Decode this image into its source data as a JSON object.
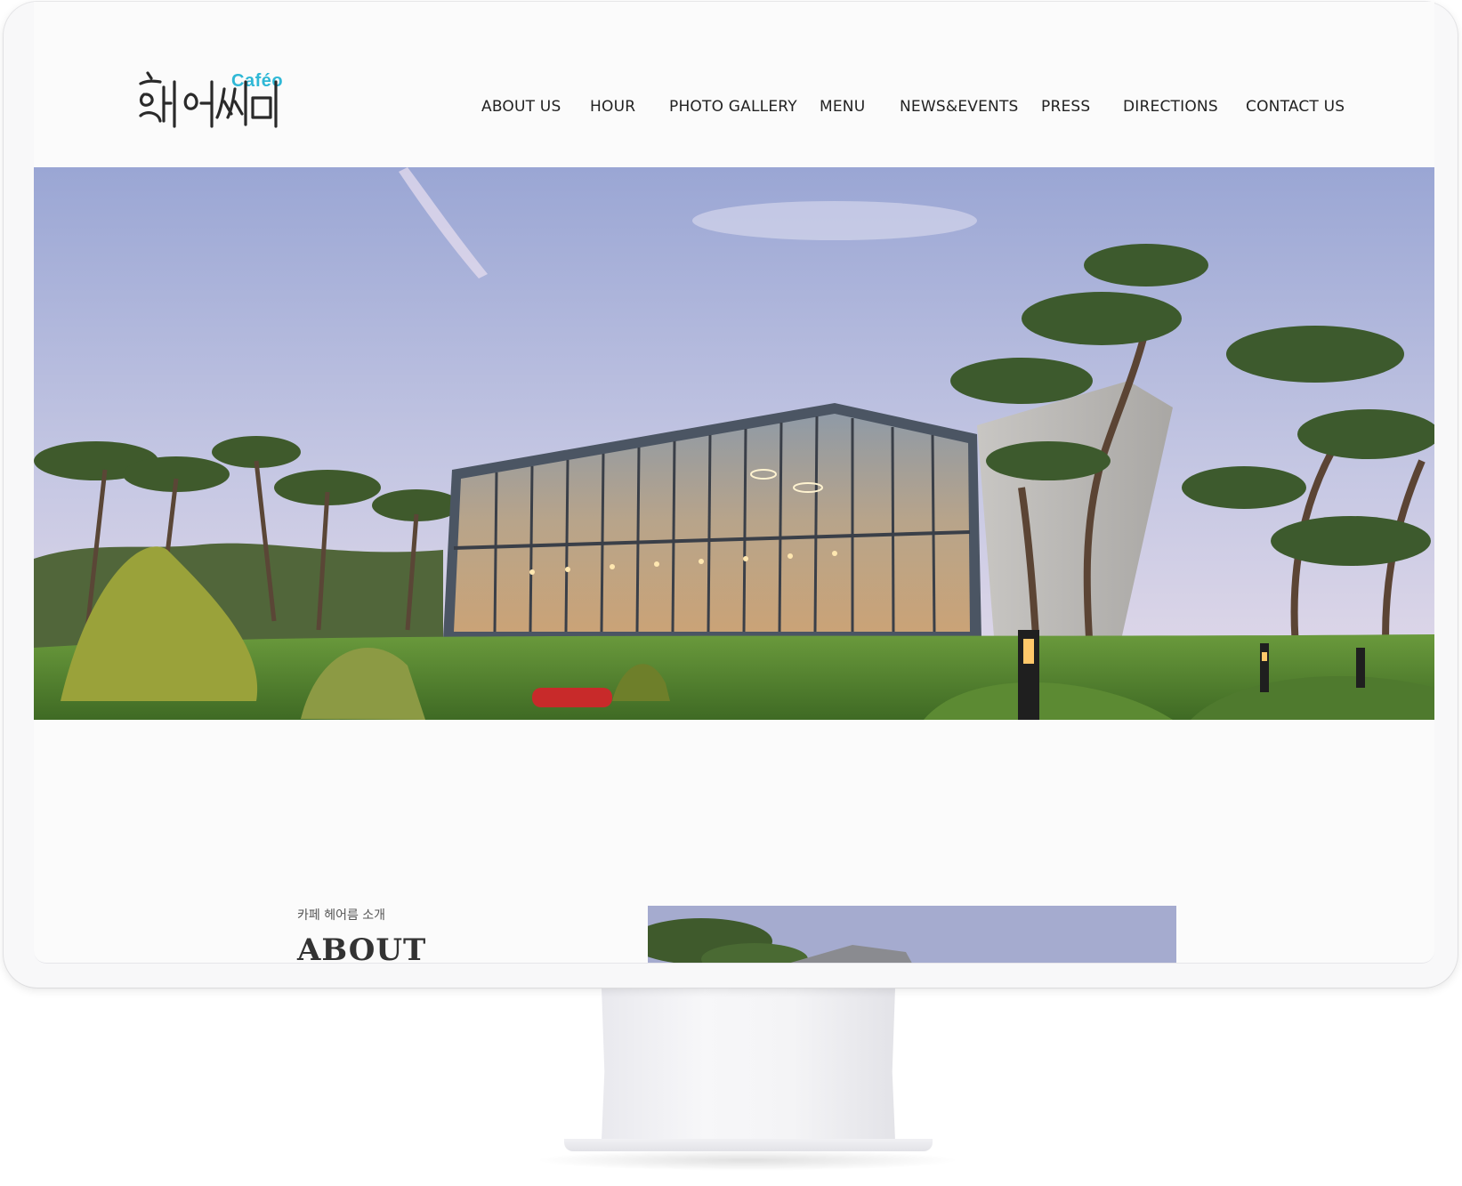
{
  "brand": {
    "logo_text": "Caféo",
    "logo_script": "해어름",
    "accent_color": "#2fb8d6"
  },
  "nav": {
    "items": [
      {
        "label": "ABOUT US"
      },
      {
        "label": "HOUR"
      },
      {
        "label": "PHOTO GALLERY"
      },
      {
        "label": "MENU"
      },
      {
        "label": "NEWS&EVENTS"
      },
      {
        "label": "PRESS"
      },
      {
        "label": "DIRECTIONS"
      },
      {
        "label": "CONTACT US"
      }
    ]
  },
  "about": {
    "kicker": "카페 헤어름 소개",
    "title": "ABOUT"
  }
}
